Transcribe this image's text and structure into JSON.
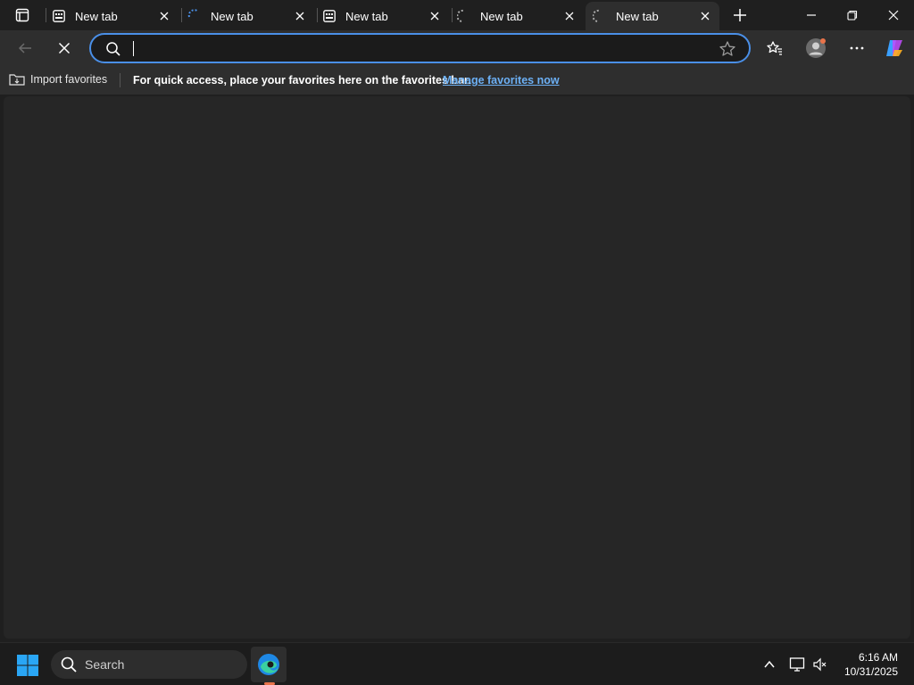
{
  "tabs": [
    {
      "title": "New tab",
      "state": "idle"
    },
    {
      "title": "New tab",
      "state": "loading"
    },
    {
      "title": "New tab",
      "state": "idle"
    },
    {
      "title": "New tab",
      "state": "loading"
    },
    {
      "title": "New tab",
      "state": "loading",
      "active": true
    }
  ],
  "toolbar": {
    "address_value": "",
    "icons": [
      "back-arrow-icon",
      "stop-loading-icon",
      "search-icon",
      "favorite-star-icon",
      "favorites-icon",
      "profile-icon",
      "more-icon",
      "copilot-icon"
    ]
  },
  "favorites_bar": {
    "import_label": "Import favorites",
    "message": "For quick access, place your favorites here on the favorites bar.",
    "manage_link": "Manage favorites now"
  },
  "taskbar": {
    "search_label": "Search",
    "time": "6:16 AM",
    "date": "10/31/2025"
  },
  "colors": {
    "accent": "#4a8fe7",
    "link": "#6cb0f5",
    "edge_indicator": "#e8734a",
    "background": "#1f1f1f",
    "content": "#262626"
  }
}
